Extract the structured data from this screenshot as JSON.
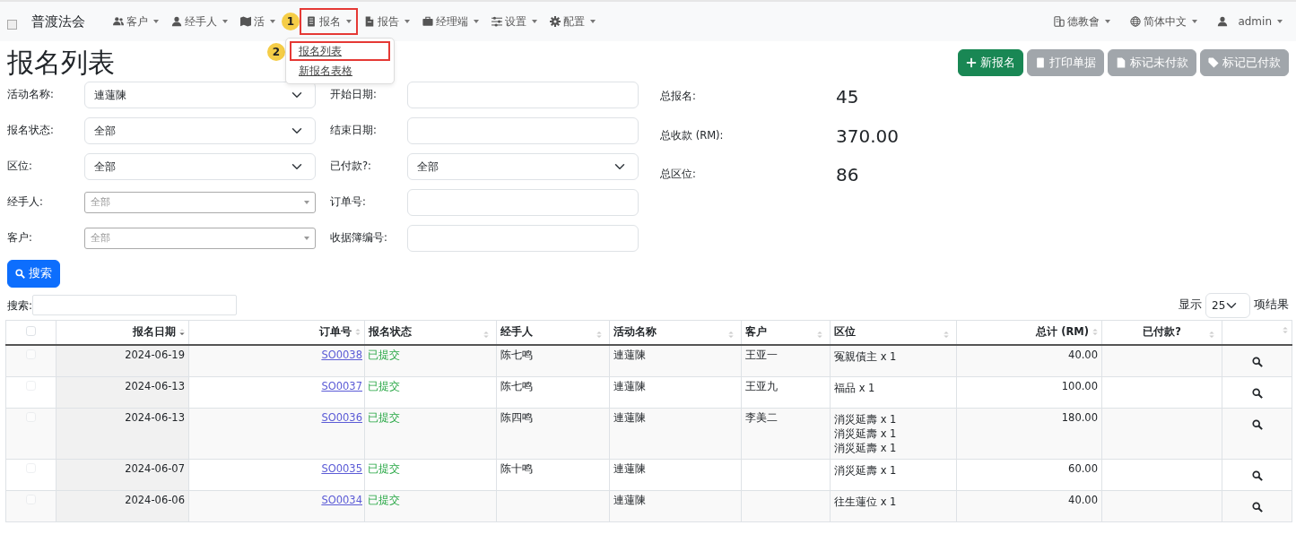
{
  "navbar": {
    "brand": "普渡法会",
    "menus": [
      {
        "label": "客户",
        "highlighted": false
      },
      {
        "label": "经手人",
        "highlighted": false
      },
      {
        "label": "活",
        "highlighted": false
      },
      {
        "label": "报名",
        "highlighted": true
      },
      {
        "label": "报告",
        "highlighted": false
      },
      {
        "label": "经理端",
        "highlighted": false
      },
      {
        "label": "设置",
        "highlighted": false
      },
      {
        "label": "配置",
        "highlighted": false
      }
    ],
    "right": [
      {
        "label": "德教會"
      },
      {
        "label": "简体中文"
      },
      {
        "label": "admin"
      }
    ]
  },
  "annotations": [
    {
      "label": "1"
    },
    {
      "label": "2"
    }
  ],
  "dropdown": {
    "items": [
      {
        "label": "报名列表",
        "highlighted": true
      },
      {
        "label": "新报名表格",
        "highlighted": false
      }
    ]
  },
  "page_title": "报名列表",
  "actions": [
    {
      "label": "新报名",
      "kind": "primary"
    },
    {
      "label": "打印单据",
      "kind": "secondary"
    },
    {
      "label": "标记未付款",
      "kind": "secondary"
    },
    {
      "label": "标记已付款",
      "kind": "secondary"
    }
  ],
  "filters_left": [
    {
      "label": "活动名称:",
      "value": "連蓮陳",
      "kind": "select"
    },
    {
      "label": "报名状态:",
      "value": "全部",
      "kind": "select"
    },
    {
      "label": "区位:",
      "value": "全部",
      "kind": "select"
    },
    {
      "label": "经手人:",
      "placeholder": "全部",
      "kind": "select2"
    },
    {
      "label": "客户:",
      "placeholder": "全部",
      "kind": "select2"
    }
  ],
  "filters_mid": [
    {
      "label": "开始日期:",
      "kind": "input"
    },
    {
      "label": "结束日期:",
      "kind": "input"
    },
    {
      "label": "已付款?:",
      "value": "全部",
      "kind": "select"
    },
    {
      "label": "订单号:",
      "kind": "input"
    },
    {
      "label": "收据簿编号:",
      "kind": "input"
    }
  ],
  "stats": [
    {
      "label": "总报名:",
      "value": "45"
    },
    {
      "label": "总收款 (RM):",
      "value": "370.00"
    },
    {
      "label": "总区位:",
      "value": "86"
    }
  ],
  "search_button": "搜索",
  "table_search_label": "搜索:",
  "page_length": {
    "prefix": "显示",
    "value": "25",
    "suffix": "项结果"
  },
  "table": {
    "select_all": {
      "checked": false
    },
    "columns": [
      {
        "label": "报名日期",
        "sorted": true
      },
      {
        "label": "订单号",
        "sorted": false
      },
      {
        "label": "报名状态",
        "sorted": false
      },
      {
        "label": "经手人",
        "sorted": false
      },
      {
        "label": "活动名称",
        "sorted": false
      },
      {
        "label": "客户",
        "sorted": false
      },
      {
        "label": "区位",
        "sorted": false
      },
      {
        "label": "总计 (RM)",
        "sorted": false
      },
      {
        "label": "已付款?",
        "sorted": false
      }
    ],
    "rows": [
      {
        "checked": false,
        "date": "2024-06-19",
        "order": "SO0038",
        "status": "已提交",
        "handler": "陈七鸣",
        "activity": "連蓮陳",
        "customer": "王亚一",
        "zones": [
          "冤親債主 x 1"
        ],
        "total": "40.00"
      },
      {
        "checked": false,
        "date": "2024-06-13",
        "order": "SO0037",
        "status": "已提交",
        "handler": "陈七鸣",
        "activity": "連蓮陳",
        "customer": "王亚九",
        "zones": [
          "福品 x 1"
        ],
        "total": "100.00"
      },
      {
        "checked": false,
        "date": "2024-06-13",
        "order": "SO0036",
        "status": "已提交",
        "handler": "陈四鸣",
        "activity": "連蓮陳",
        "customer": "李美二",
        "zones": [
          "消災延壽 x 1",
          "消災延壽 x 1",
          "消災延壽 x 1"
        ],
        "total": "180.00"
      },
      {
        "checked": false,
        "date": "2024-06-07",
        "order": "SO0035",
        "status": "已提交",
        "handler": "陈十鸣",
        "activity": "連蓮陳",
        "customer": "",
        "zones": [
          "消災延壽 x 1"
        ],
        "total": "60.00"
      },
      {
        "checked": false,
        "date": "2024-06-06",
        "order": "SO0034",
        "status": "已提交",
        "handler": "",
        "activity": "連蓮陳",
        "customer": "",
        "zones": [
          "往生蓮位 x 1"
        ],
        "total": "40.00"
      }
    ]
  }
}
